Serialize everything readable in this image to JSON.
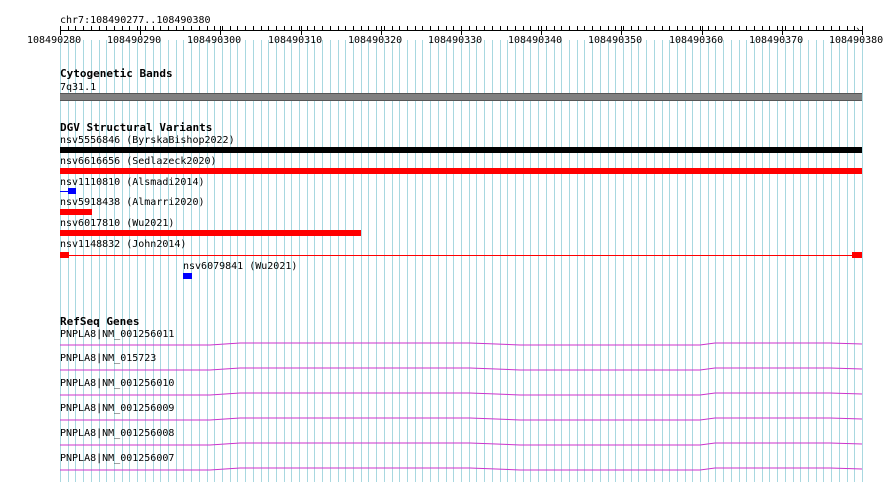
{
  "ruler": {
    "region": "chr7:108490277..108490380",
    "start": 108490277,
    "end": 108490380,
    "tick_labels": [
      "108490280",
      "108490290",
      "108490300",
      "108490310",
      "108490320",
      "108490330",
      "108490340",
      "108490350",
      "108490360",
      "108490370",
      "108490380"
    ]
  },
  "cytobands": {
    "title": "Cytogenetic Bands",
    "band_label": "7q31.1",
    "band_color": "#808080"
  },
  "dgv": {
    "title": "DGV Structural Variants",
    "variants": [
      {
        "label": "nsv5556846 (ByrskaBishop2022)",
        "color": "#000000"
      },
      {
        "label": "nsv6616656 (Sedlazeck2020)",
        "color": "#ff0000"
      },
      {
        "label": "nsv1110810 (Alsmadi2014)",
        "color": "#0000ff"
      },
      {
        "label": "nsv5918438 (Almarri2020)",
        "color": "#ff0000"
      },
      {
        "label": "nsv6017810 (Wu2021)",
        "color": "#ff0000"
      },
      {
        "label": "nsv1148832 (John2014)",
        "color": "#ff0000"
      },
      {
        "label": "nsv6079841 (Wu2021)",
        "color": "#0000ff"
      }
    ]
  },
  "refseq": {
    "title": "RefSeq Genes",
    "line_color": "#cc33cc",
    "genes": [
      {
        "label": "PNPLA8|NM_001256011"
      },
      {
        "label": "PNPLA8|NM_015723"
      },
      {
        "label": "PNPLA8|NM_001256010"
      },
      {
        "label": "PNPLA8|NM_001256009"
      },
      {
        "label": "PNPLA8|NM_001256008"
      },
      {
        "label": "PNPLA8|NM_001256007"
      }
    ]
  }
}
